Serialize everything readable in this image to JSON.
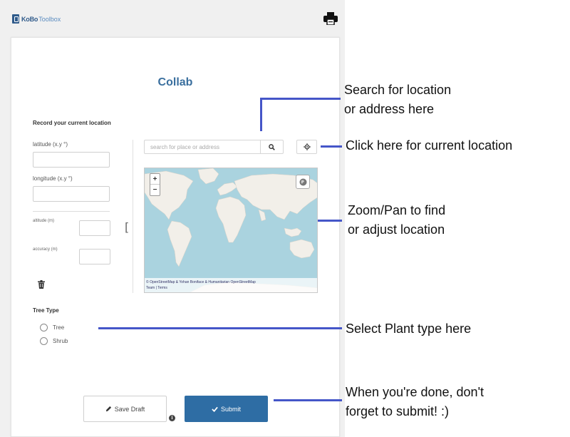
{
  "app": {
    "brand_bold": "KoBo",
    "brand_light": "Toolbox",
    "print_icon": "printer-icon"
  },
  "form": {
    "title": "Collab",
    "location_section_label": "Record your current location",
    "latitude_label": "latitude (x.y °)",
    "longitude_label": "longitude (x.y °)",
    "altitude_label": "altitude (m)",
    "accuracy_label": "accuracy (m)",
    "latitude_value": "",
    "longitude_value": "",
    "altitude_value": "",
    "accuracy_value": "",
    "bracket": "[",
    "search_placeholder": "search for place or address",
    "map_attribution_line1": "© OpenStreetMap & Yohan Boniface & Humanitarian OpenStreetMap",
    "map_attribution_line2": "Team | Terms",
    "zoom_in": "+",
    "zoom_out": "−",
    "tree_type_label": "Tree Type",
    "options": [
      {
        "label": "Tree"
      },
      {
        "label": "Shrub"
      }
    ],
    "save_draft_label": "Save Draft",
    "submit_label": "Submit",
    "info": "i"
  },
  "annotations": {
    "search_line1": "Search for location",
    "search_line2": "or address here",
    "current_location": "Click here for current location",
    "zoom_line1": "Zoom/Pan to find",
    "zoom_line2": "or adjust location",
    "select_type": "Select Plant type here",
    "done_line1": "When you're done, don't",
    "done_line2": "forget to submit! :)"
  },
  "colors": {
    "accent": "#2e6da4",
    "title": "#3a6f9e",
    "annotation_line": "#4556c8",
    "map_water": "#aad3df",
    "map_land": "#f2efe9"
  }
}
